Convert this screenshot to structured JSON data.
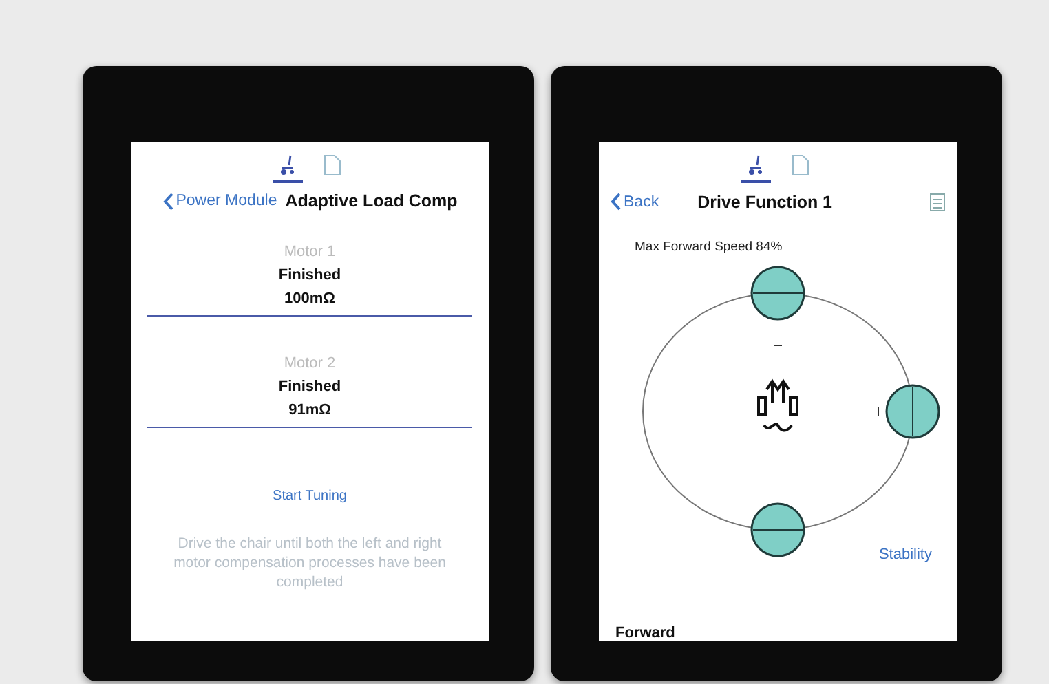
{
  "devices": [
    {
      "kind": "motor_tuning",
      "tabs": [
        {
          "kind": "wheelchair",
          "selected": true
        },
        {
          "kind": "document",
          "selected": false
        }
      ],
      "back_label": "Power Module",
      "title": "Adaptive Load Comp",
      "motors": [
        {
          "label": "Motor 1",
          "status": "Finished",
          "value": "100mΩ"
        },
        {
          "label": "Motor 2",
          "status": "Finished",
          "value": "91mΩ"
        }
      ],
      "action": "Start Tuning",
      "note": "Drive the chair until both the left and right motor compensation processes have been completed"
    },
    {
      "kind": "drive_function",
      "tabs": [
        {
          "kind": "wheelchair",
          "selected": true
        },
        {
          "kind": "document",
          "selected": false
        }
      ],
      "back_label": "Back",
      "title": "Drive Function 1",
      "speed_label": "Max Forward Speed 84%",
      "link": "Stability",
      "section": "Forward"
    }
  ]
}
